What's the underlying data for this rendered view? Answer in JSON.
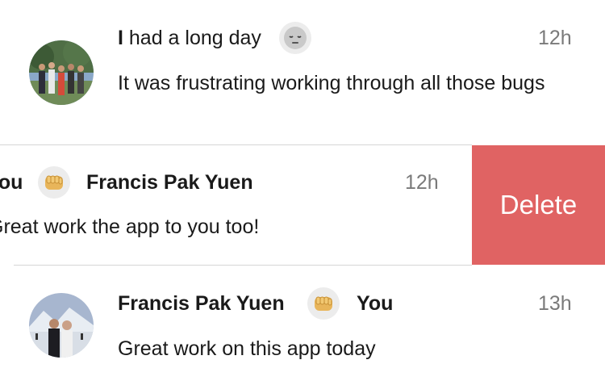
{
  "colors": {
    "delete_bg": "#e06363",
    "badge_bg": "#ececec",
    "time": "#7a7a7a"
  },
  "messages": [
    {
      "title_bold": "I",
      "title_rest": " had a long day",
      "emoji": "sad-face-icon",
      "time": "12h",
      "body": "It was frustrating working through all those bugs"
    },
    {
      "from": "You",
      "emoji": "fist-bump-icon",
      "to": "Francis Pak Yuen",
      "time": "12h",
      "body": "Great work the app to you too!",
      "delete_label": "Delete"
    },
    {
      "from": "Francis Pak Yuen",
      "emoji": "fist-bump-icon",
      "to": "You",
      "time": "13h",
      "body": "Great work on this app today"
    }
  ]
}
